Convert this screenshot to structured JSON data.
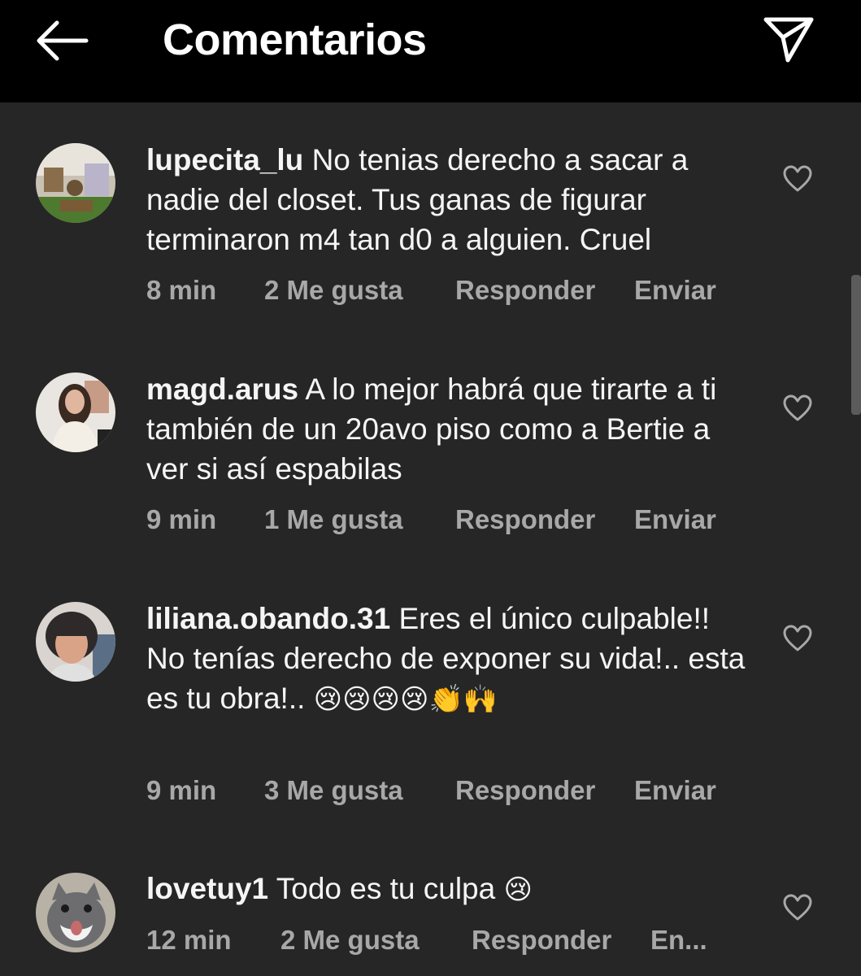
{
  "header": {
    "title": "Comentarios",
    "back_icon": "back-arrow-icon",
    "send_icon": "send-icon"
  },
  "comments": [
    {
      "username": "lupecita_lu",
      "text": "No tenias derecho a sacar a nadie del closet. Tus ganas de figurar terminaron m4 tan d0  a alguien. Cruel",
      "time": "8 min",
      "likes": "2 Me gusta",
      "reply": "Responder",
      "send": "Enviar"
    },
    {
      "username": "magd.arus",
      "text": "A lo mejor habrá que tirarte a ti también de un 20avo piso como a Bertie a ver si así espabilas",
      "time": "9 min",
      "likes": "1 Me gusta",
      "reply": "Responder",
      "send": "Enviar"
    },
    {
      "username": "liliana.obando.31",
      "text": "Eres el único culpable!! No tenías derecho de exponer su vida!.. esta es tu obra!..",
      "emojis": "😢😢😢😢👏🙌",
      "time": "9 min",
      "likes": "3 Me gusta",
      "reply": "Responder",
      "send": "Enviar"
    },
    {
      "username": "lovetuy1",
      "text": "Todo es tu culpa",
      "emojis": "😢",
      "time": "12 min",
      "likes": "2 Me gusta",
      "reply": "Responder",
      "send": "En..."
    }
  ],
  "colors": {
    "background": "#262626",
    "header": "#000000",
    "text": "#f5f5f5",
    "secondary": "#a8a8a8"
  }
}
